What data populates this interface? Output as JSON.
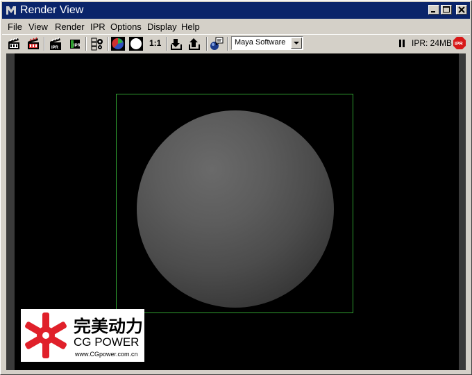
{
  "window": {
    "title": "Render View"
  },
  "menu": [
    "File",
    "View",
    "Render",
    "IPR",
    "Options",
    "Display",
    "Help"
  ],
  "toolbar": {
    "ratio_label": "1:1",
    "renderer": "Maya Software",
    "ipr_status": "IPR: 24MB",
    "ipr_stop_label": "IPR"
  },
  "watermark": {
    "chinese": "完美动力",
    "english": "CG POWER",
    "url": "www.CGpower.com.cn"
  },
  "colors": {
    "titlebar": "#0a246a",
    "region_box": "#2fa030",
    "logo_red": "#e0202a",
    "stop_red": "#d81818"
  },
  "icons": [
    "maya-icon",
    "minimize-icon",
    "maximize-icon",
    "close-icon",
    "redo-render-icon",
    "render-region-icon",
    "ipr-render-icon",
    "ipr-refresh-icon",
    "render-settings-icon",
    "color-channels-icon",
    "alpha-channel-icon",
    "keep-image-icon",
    "remove-image-icon",
    "render-diagnostics-icon",
    "pause-icon",
    "stop-ipr-icon"
  ]
}
